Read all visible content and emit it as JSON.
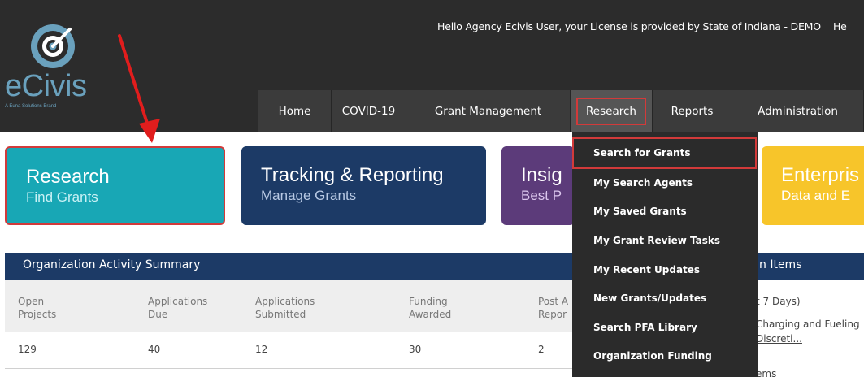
{
  "header": {
    "greeting": "Hello Agency Ecivis User, your License is provided by State of Indiana - DEMO",
    "greeting_trail": "He"
  },
  "logo": {
    "wordmark": "eCivis",
    "tagline": "A Euna Solutions Brand",
    "icon": "ecivis-target-icon"
  },
  "nav": {
    "items": [
      {
        "label": "Home"
      },
      {
        "label": "COVID-19"
      },
      {
        "label": "Grant Management"
      },
      {
        "label": "Research",
        "active": true
      },
      {
        "label": "Reports"
      },
      {
        "label": "Administration"
      }
    ]
  },
  "research_menu": {
    "items": [
      {
        "label": "Search for Grants",
        "highlighted": true
      },
      {
        "label": "My Search Agents"
      },
      {
        "label": "My Saved Grants"
      },
      {
        "label": "My Grant Review Tasks"
      },
      {
        "label": "My Recent Updates"
      },
      {
        "label": "New Grants/Updates"
      },
      {
        "label": "Search PFA Library"
      },
      {
        "label": "Organization Funding"
      }
    ]
  },
  "tiles": {
    "research": {
      "title": "Research",
      "subtitle": "Find Grants"
    },
    "tracking": {
      "title": "Tracking & Reporting",
      "subtitle": "Manage Grants"
    },
    "insights": {
      "title": "Insig",
      "subtitle": "Best P"
    },
    "enterprise": {
      "title": "Enterpris",
      "subtitle": "Data and E"
    }
  },
  "summary": {
    "title": "Organization Activity Summary",
    "columns": [
      {
        "header": "Open\nProjects",
        "value": "129"
      },
      {
        "header": "Applications\nDue",
        "value": "40"
      },
      {
        "header": "Applications\nSubmitted",
        "value": "12"
      },
      {
        "header": "Funding\nAwarded",
        "value": "30"
      },
      {
        "header": "Post A\nRepor",
        "value": "2"
      }
    ]
  },
  "right_panel": {
    "title": "n Items",
    "period": "t 7 Days)",
    "item_line1": "Charging and Fueling",
    "item_line2": "Discreti...",
    "footer": "ems"
  },
  "colors": {
    "header_bg": "#2c2c2c",
    "nav_bg": "#3b3b3b",
    "research_teal": "#18a7b5",
    "tracking_navy": "#1c3a66",
    "insights_purple": "#5c3b7a",
    "enterprise_yellow": "#f7c52a",
    "highlight_red": "#d23a3a"
  }
}
